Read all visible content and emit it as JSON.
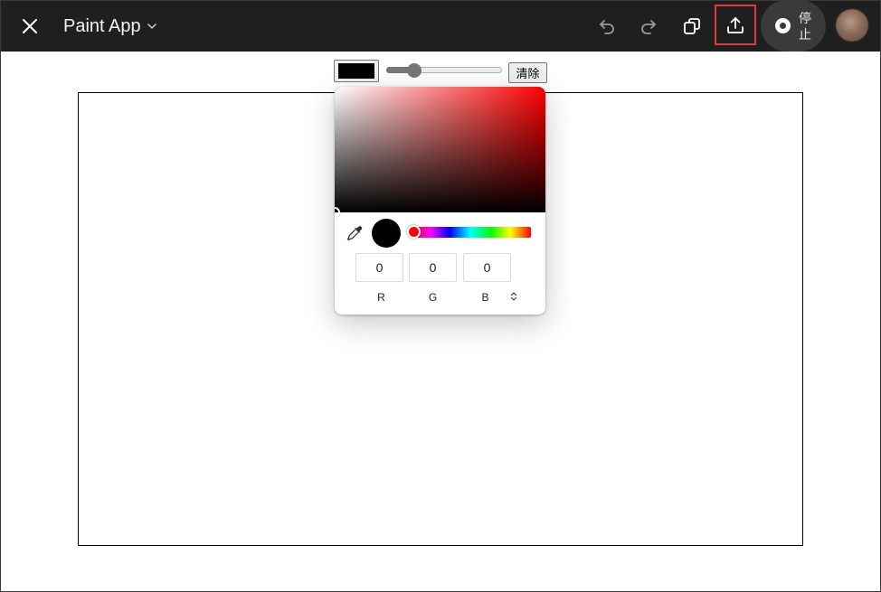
{
  "header": {
    "title": "Paint App",
    "stop_label": "停止",
    "icons": {
      "close": "close-icon",
      "dropdown": "chevron-down-icon",
      "undo": "undo-icon",
      "redo": "redo-icon",
      "copy": "copy-icon",
      "share": "share-icon",
      "stop": "stop-record-icon"
    }
  },
  "toolbar": {
    "current_color": "#000000",
    "brush_size_fraction": 0.24,
    "clear_label": "清除"
  },
  "color_picker": {
    "hue_color": "#ff0000",
    "selected_color": "#000000",
    "r": "0",
    "g": "0",
    "b": "0",
    "r_label": "R",
    "g_label": "G",
    "b_label": "B",
    "eyedropper_icon": "eyedropper-icon",
    "mode_toggle_icon": "up-down-chevron-icon"
  },
  "colors": {
    "topbar_bg": "#1f1f1f",
    "share_highlight": "#e23b3b",
    "stop_bg": "#3a3a3a"
  }
}
